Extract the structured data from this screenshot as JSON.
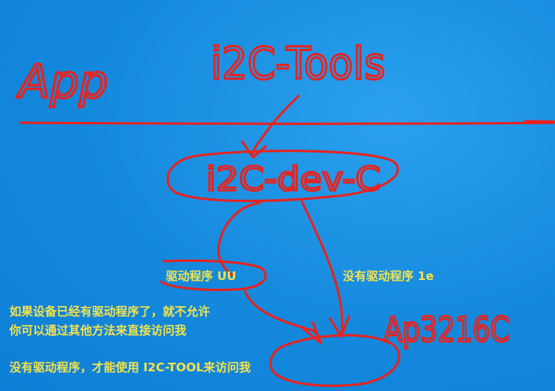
{
  "handwritten": {
    "app": "App",
    "i2c_tools": "i2C-Tools",
    "i2c_dev_c": "i2C-dev-C",
    "chip": "Ap3216C"
  },
  "labels": {
    "with_driver": "驱动程序 UU",
    "without_driver": "没有驱动程序 1e",
    "note_line1": "如果设备已经有驱动程序了，就不允许",
    "note_line2": "你可以通过其他方法来直接访问我",
    "note_line3": "没有驱动程序，才能使用 I2C-TOOL来访问我"
  },
  "colors": {
    "ink": "#e8231f",
    "label": "#f4e24a",
    "background": "#1489dc"
  }
}
